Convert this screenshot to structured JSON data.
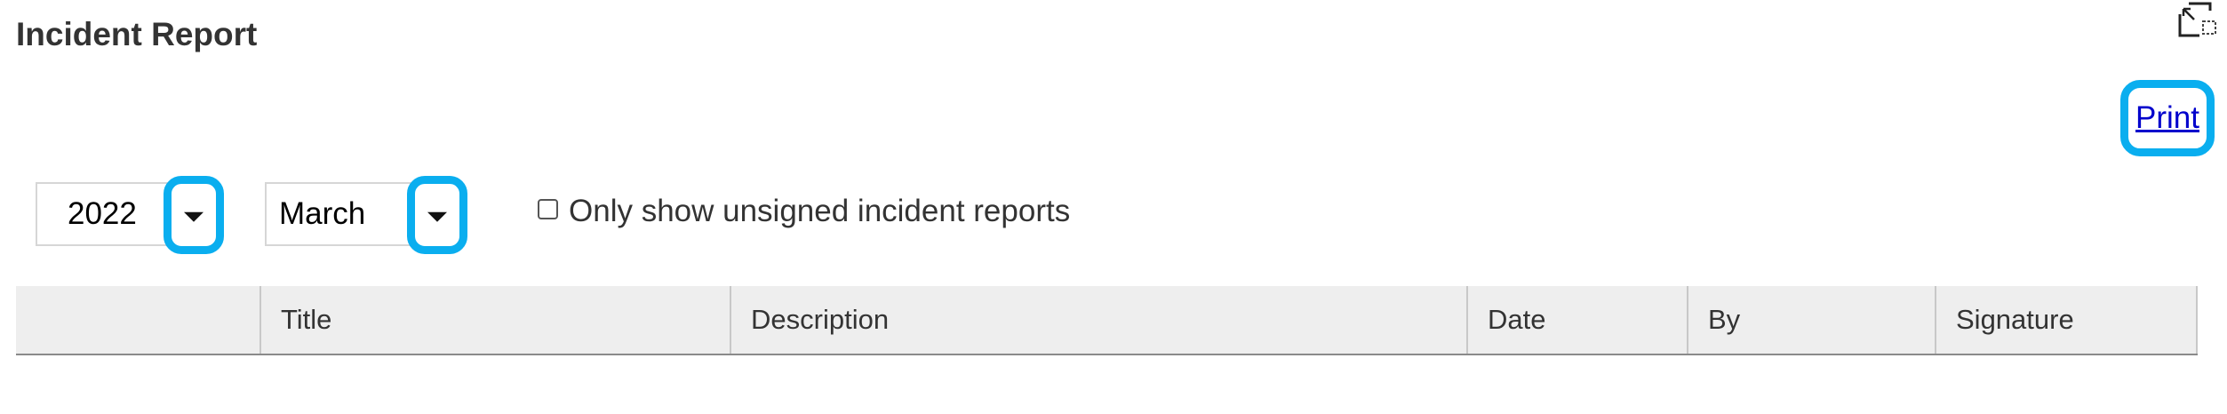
{
  "header": {
    "title": "Incident Report"
  },
  "toolbar": {
    "print_label": "Print"
  },
  "filters": {
    "year_value": "2022",
    "month_value": "March",
    "unsigned_label": "Only show unsigned incident reports",
    "unsigned_checked": false
  },
  "table": {
    "columns": [
      "",
      "Title",
      "Description",
      "Date",
      "By",
      "Signature"
    ]
  },
  "icons": {
    "expand": "expand-icon",
    "dropdown": "caret-down-icon"
  },
  "colors": {
    "highlight": "#0aaeef",
    "link": "#0000cc",
    "header_bg": "#eeeeee"
  }
}
